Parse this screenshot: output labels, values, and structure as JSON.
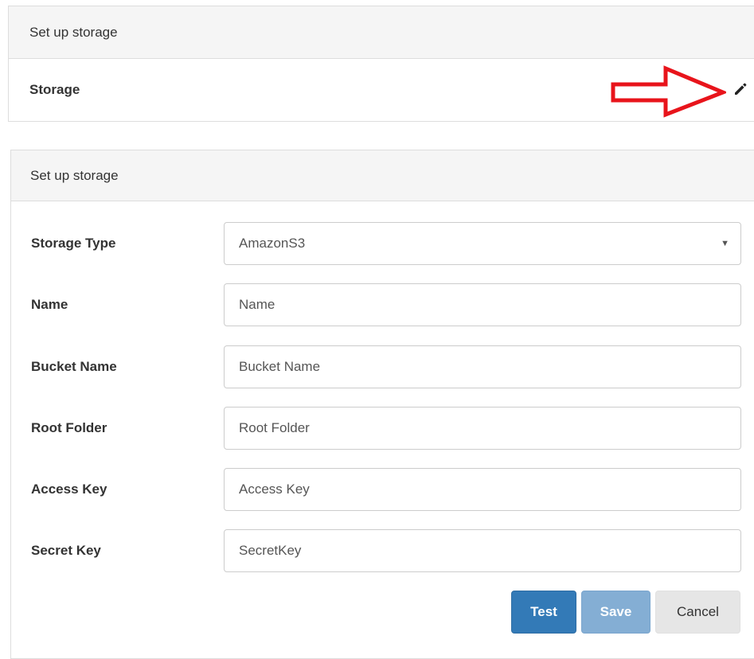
{
  "top_panel": {
    "heading": "Set up storage",
    "storage_label": "Storage",
    "edit_icon": "pencil-icon"
  },
  "annotation": {
    "arrow_icon": "red-outline-arrow-icon",
    "color": "#e8141b"
  },
  "form_panel": {
    "heading": "Set up storage",
    "fields": [
      {
        "label": "Storage Type",
        "value": "AmazonS3",
        "type": "select"
      },
      {
        "label": "Name",
        "placeholder": "Name"
      },
      {
        "label": "Bucket Name",
        "placeholder": "Bucket Name"
      },
      {
        "label": "Root Folder",
        "placeholder": "Root Folder"
      },
      {
        "label": "Access Key",
        "placeholder": "Access Key"
      },
      {
        "label": "Secret Key",
        "placeholder": "SecretKey"
      }
    ],
    "buttons": {
      "test": "Test",
      "save": "Save",
      "cancel": "Cancel"
    }
  },
  "colors": {
    "primary": "#337ab7",
    "primary_disabled": "#84aed4",
    "panel_heading_bg": "#f5f5f5"
  }
}
